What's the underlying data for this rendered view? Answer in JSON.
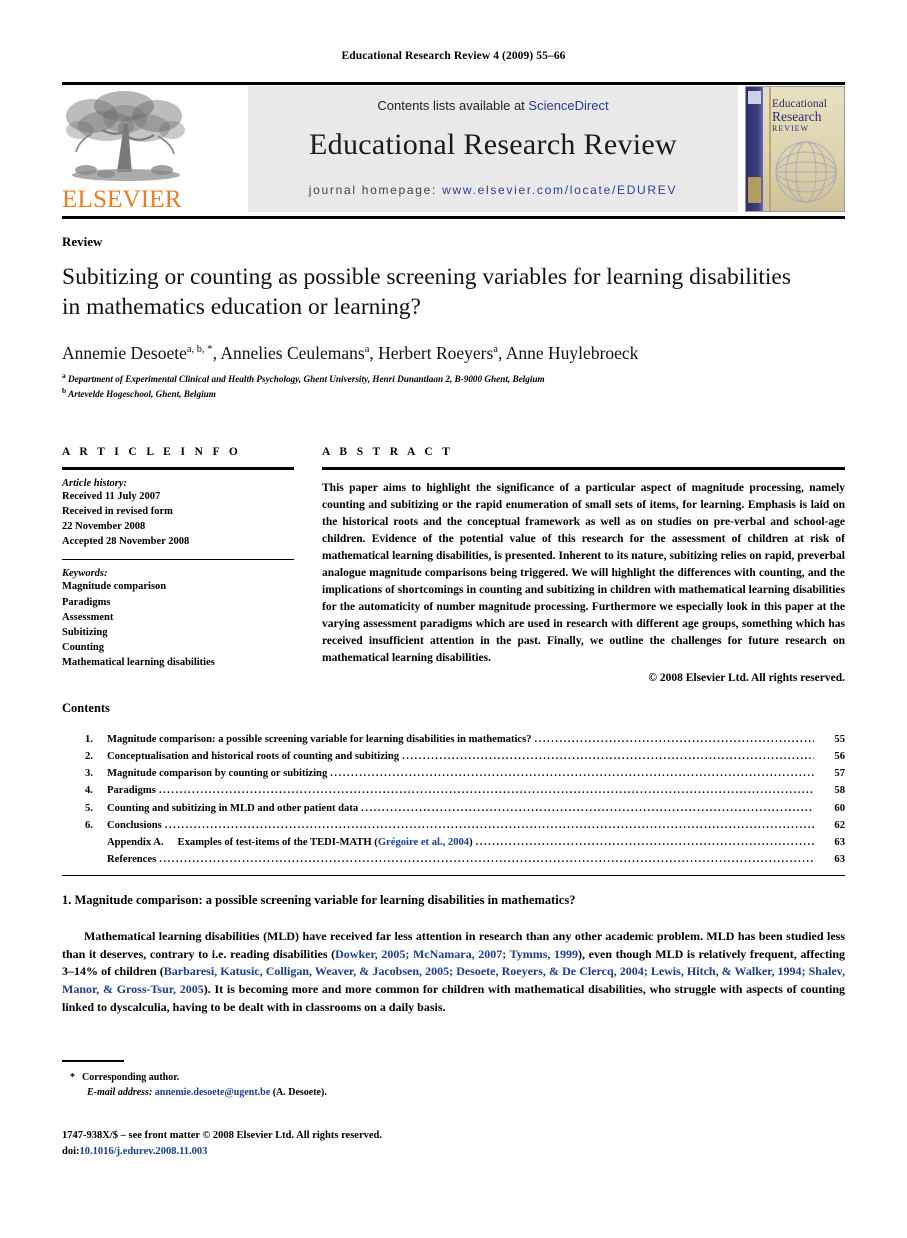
{
  "running_head": "Educational Research Review 4 (2009) 55–66",
  "masthead": {
    "contents_prefix": "Contents lists available at ",
    "sciencedirect": "ScienceDirect",
    "journal_title": "Educational Research Review",
    "homepage_prefix": "journal homepage:",
    "homepage_url": "www.elsevier.com/locate/EDUREV",
    "publisher_wordmark": "ELSEVIER",
    "cover": {
      "line1": "Educational",
      "line2": "Research",
      "line3": "REVIEW"
    },
    "colors": {
      "elsevier_orange": "#EE7D22",
      "link_blue": "#2c3f95",
      "banner_gray": "#e9e9e9",
      "cover_navy": "#2b2f6b"
    }
  },
  "article": {
    "type": "Review",
    "title": "Subitizing or counting as possible screening variables for learning disabilities in mathematics education or learning?",
    "authors": [
      {
        "name": "Annemie Desoete",
        "marks": "a, b, *"
      },
      {
        "name": "Annelies Ceulemans",
        "marks": "a"
      },
      {
        "name": "Herbert Roeyers",
        "marks": "a"
      },
      {
        "name": "Anne Huylebroeck",
        "marks": ""
      }
    ],
    "affiliations": [
      {
        "mark": "a",
        "text": "Department of Experimental Clinical and Health Psychology, Ghent University, Henri Dunantlaan 2, B-9000 Ghent, Belgium"
      },
      {
        "mark": "b",
        "text": "Artevelde Hogeschool, Ghent, Belgium"
      }
    ]
  },
  "article_info": {
    "label": "A R T I C L E   I N F O",
    "history_label": "Article history:",
    "history": [
      "Received 11 July 2007",
      "Received in revised form",
      "22 November 2008",
      "Accepted 28 November 2008"
    ],
    "keywords_label": "Keywords:",
    "keywords": [
      "Magnitude comparison",
      "Paradigms",
      "Assessment",
      "Subitizing",
      "Counting",
      "Mathematical learning disabilities"
    ]
  },
  "abstract": {
    "label": "A B S T R A C T",
    "text": "This paper aims to highlight the significance of a particular aspect of magnitude processing, namely counting and subitizing or the rapid enumeration of small sets of items, for learning. Emphasis is laid on the historical roots and the conceptual framework as well as on studies on pre-verbal and school-age children. Evidence of the potential value of this research for the assessment of children at risk of mathematical learning disabilities, is presented. Inherent to its nature, subitizing relies on rapid, preverbal analogue magnitude comparisons being triggered. We will highlight the differences with counting, and the implications of shortcomings in counting and subitizing in children with mathematical learning disabilities for the automaticity of number magnitude processing. Furthermore we especially look in this paper at the varying assessment paradigms which are used in research with different age groups, something which has received insufficient attention in the past. Finally, we outline the challenges for future research on mathematical learning disabilities.",
    "copyright": "© 2008 Elsevier Ltd. All rights reserved."
  },
  "contents": {
    "heading": "Contents",
    "entries": [
      {
        "num": "1.",
        "text": "Magnitude comparison: a possible screening variable for learning disabilities in mathematics?",
        "page": "55"
      },
      {
        "num": "2.",
        "text": "Conceptualisation and historical roots of counting and subitizing",
        "page": "56"
      },
      {
        "num": "3.",
        "text": "Magnitude comparison by counting or subitizing",
        "page": "57"
      },
      {
        "num": "4.",
        "text": "Paradigms",
        "page": "58"
      },
      {
        "num": "5.",
        "text": "Counting and subitizing in MLD and other patient data",
        "page": "60"
      },
      {
        "num": "6.",
        "text": "Conclusions",
        "page": "62"
      },
      {
        "num": "",
        "label": "Appendix A.",
        "text": "Examples of test-items of the TEDI-MATH (",
        "cite": "Grégoire et al., 2004",
        "text_after": ")",
        "page": "63"
      },
      {
        "num": "",
        "text": "References",
        "page": "63",
        "indent": true
      }
    ]
  },
  "section1": {
    "heading": "1.  Magnitude comparison: a possible screening variable for learning disabilities in mathematics?",
    "paragraph_parts": [
      {
        "t": "Mathematical learning disabilities (MLD) have received far less attention in research than any other academic problem. MLD has been studied less than it deserves, contrary to i.e. reading disabilities (",
        "c": false
      },
      {
        "t": "Dowker, 2005; McNamara, 2007; Tymms, 1999",
        "c": true
      },
      {
        "t": "), even though MLD is relatively frequent, affecting 3–14% of children (",
        "c": false
      },
      {
        "t": "Barbaresi, Katusic, Colligan, Weaver, & Jacobsen, 2005; Desoete, Roeyers, & De Clercq, 2004; Lewis, Hitch, & Walker, 1994; Shalev, Manor, & Gross-Tsur, 2005",
        "c": true
      },
      {
        "t": "). It is becoming more and more common for children with mathematical disabilities, who struggle with aspects of counting linked to dyscalculia, having to be dealt with in classrooms on a daily basis.",
        "c": false
      }
    ]
  },
  "footnote": {
    "star": "*",
    "corresponding": "Corresponding author.",
    "email_label": "E-mail address:",
    "email": "annemie.desoete@ugent.be",
    "email_suffix": "(A. Desoete)."
  },
  "imprint": {
    "line1": "1747-938X/$ – see front matter © 2008 Elsevier Ltd. All rights reserved.",
    "doi_label": "doi:",
    "doi": "10.1016/j.edurev.2008.11.003"
  }
}
